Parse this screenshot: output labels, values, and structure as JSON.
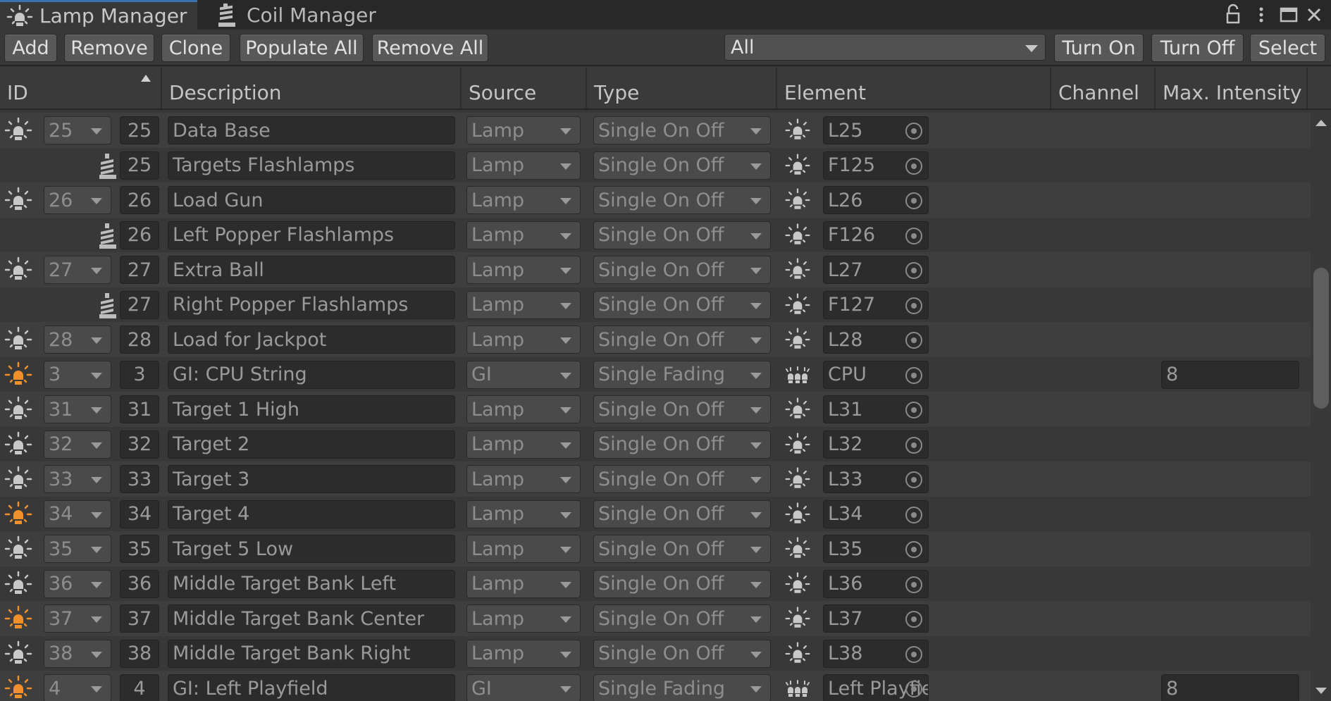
{
  "tabs": {
    "lamp_manager": "Lamp Manager",
    "coil_manager": "Coil Manager"
  },
  "toolbar": {
    "add": "Add",
    "remove": "Remove",
    "clone": "Clone",
    "populate_all": "Populate All",
    "remove_all": "Remove All",
    "filter_value": "All",
    "turn_on": "Turn On",
    "turn_off": "Turn Off",
    "select": "Select"
  },
  "columns": {
    "id": "ID",
    "description": "Description",
    "source": "Source",
    "type": "Type",
    "element": "Element",
    "channel": "Channel",
    "max_intensity": "Max. Intensity"
  },
  "colors": {
    "lamp_on": "#f0902a",
    "lamp_off": "#c8c8c8",
    "tab_accent": "#3a72b0"
  },
  "rows": [
    {
      "icon": "lamp-icon",
      "lit": false,
      "id_select": "25",
      "id": "25",
      "description": "Data Base",
      "source": "Lamp",
      "type": "Single On Off",
      "element_icon": "lamp-icon",
      "element": "L25",
      "max_intensity": ""
    },
    {
      "icon": "coil-icon",
      "lit": false,
      "id_select": "",
      "id": "25",
      "description": "Targets Flashlamps",
      "source": "Lamp",
      "type": "Single On Off",
      "element_icon": "lamp-icon",
      "element": "F125",
      "max_intensity": ""
    },
    {
      "icon": "lamp-icon",
      "lit": false,
      "id_select": "26",
      "id": "26",
      "description": "Load Gun",
      "source": "Lamp",
      "type": "Single On Off",
      "element_icon": "lamp-icon",
      "element": "L26",
      "max_intensity": ""
    },
    {
      "icon": "coil-icon",
      "lit": false,
      "id_select": "",
      "id": "26",
      "description": "Left Popper Flashlamps",
      "source": "Lamp",
      "type": "Single On Off",
      "element_icon": "lamp-icon",
      "element": "F126",
      "max_intensity": ""
    },
    {
      "icon": "lamp-icon",
      "lit": false,
      "id_select": "27",
      "id": "27",
      "description": "Extra Ball",
      "source": "Lamp",
      "type": "Single On Off",
      "element_icon": "lamp-icon",
      "element": "L27",
      "max_intensity": ""
    },
    {
      "icon": "coil-icon",
      "lit": false,
      "id_select": "",
      "id": "27",
      "description": "Right Popper Flashlamps",
      "source": "Lamp",
      "type": "Single On Off",
      "element_icon": "lamp-icon",
      "element": "F127",
      "max_intensity": ""
    },
    {
      "icon": "lamp-icon",
      "lit": false,
      "id_select": "28",
      "id": "28",
      "description": "Load for Jackpot",
      "source": "Lamp",
      "type": "Single On Off",
      "element_icon": "lamp-icon",
      "element": "L28",
      "max_intensity": ""
    },
    {
      "icon": "lamp-icon",
      "lit": true,
      "id_select": "3",
      "id": "3",
      "description": "GI: CPU String",
      "source": "GI",
      "type": "Single Fading",
      "element_icon": "gi-string-icon",
      "element": "CPU",
      "max_intensity": "8"
    },
    {
      "icon": "lamp-icon",
      "lit": false,
      "id_select": "31",
      "id": "31",
      "description": "Target 1 High",
      "source": "Lamp",
      "type": "Single On Off",
      "element_icon": "lamp-icon",
      "element": "L31",
      "max_intensity": ""
    },
    {
      "icon": "lamp-icon",
      "lit": false,
      "id_select": "32",
      "id": "32",
      "description": "Target 2",
      "source": "Lamp",
      "type": "Single On Off",
      "element_icon": "lamp-icon",
      "element": "L32",
      "max_intensity": ""
    },
    {
      "icon": "lamp-icon",
      "lit": false,
      "id_select": "33",
      "id": "33",
      "description": "Target 3",
      "source": "Lamp",
      "type": "Single On Off",
      "element_icon": "lamp-icon",
      "element": "L33",
      "max_intensity": ""
    },
    {
      "icon": "lamp-icon",
      "lit": true,
      "id_select": "34",
      "id": "34",
      "description": "Target 4",
      "source": "Lamp",
      "type": "Single On Off",
      "element_icon": "lamp-icon",
      "element": "L34",
      "max_intensity": ""
    },
    {
      "icon": "lamp-icon",
      "lit": false,
      "id_select": "35",
      "id": "35",
      "description": "Target 5 Low",
      "source": "Lamp",
      "type": "Single On Off",
      "element_icon": "lamp-icon",
      "element": "L35",
      "max_intensity": ""
    },
    {
      "icon": "lamp-icon",
      "lit": false,
      "id_select": "36",
      "id": "36",
      "description": "Middle Target Bank Left",
      "source": "Lamp",
      "type": "Single On Off",
      "element_icon": "lamp-icon",
      "element": "L36",
      "max_intensity": ""
    },
    {
      "icon": "lamp-icon",
      "lit": true,
      "id_select": "37",
      "id": "37",
      "description": "Middle Target Bank Center",
      "source": "Lamp",
      "type": "Single On Off",
      "element_icon": "lamp-icon",
      "element": "L37",
      "max_intensity": ""
    },
    {
      "icon": "lamp-icon",
      "lit": false,
      "id_select": "38",
      "id": "38",
      "description": "Middle Target Bank Right",
      "source": "Lamp",
      "type": "Single On Off",
      "element_icon": "lamp-icon",
      "element": "L38",
      "max_intensity": ""
    },
    {
      "icon": "lamp-icon",
      "lit": true,
      "id_select": "4",
      "id": "4",
      "description": "GI: Left Playfield",
      "source": "GI",
      "type": "Single Fading",
      "element_icon": "gi-string-icon",
      "element": "Left Playfield",
      "max_intensity": "8"
    }
  ]
}
